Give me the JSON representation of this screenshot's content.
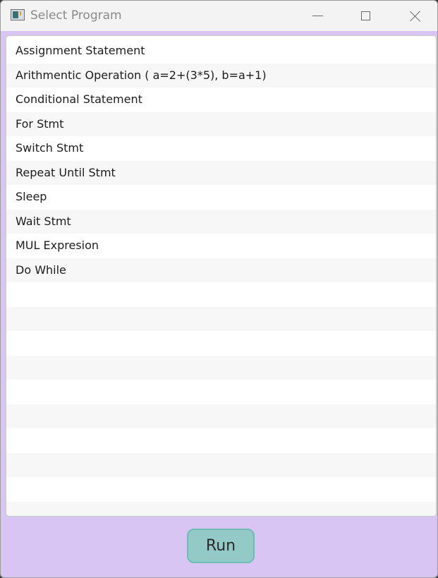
{
  "window": {
    "title": "Select Program"
  },
  "program_list": {
    "items": [
      "Assignment Statement",
      "Arithmentic Operation ( a=2+(3*5), b=a+1)",
      "Conditional Statement",
      "For Stmt",
      "Switch Stmt",
      "Repeat Until Stmt",
      "Sleep",
      "Wait Stmt",
      "MUL Expresion",
      "Do While"
    ]
  },
  "actions": {
    "run_label": "Run"
  },
  "colors": {
    "footer_background": "#d8c5f3",
    "run_button": "#93c9c6"
  }
}
